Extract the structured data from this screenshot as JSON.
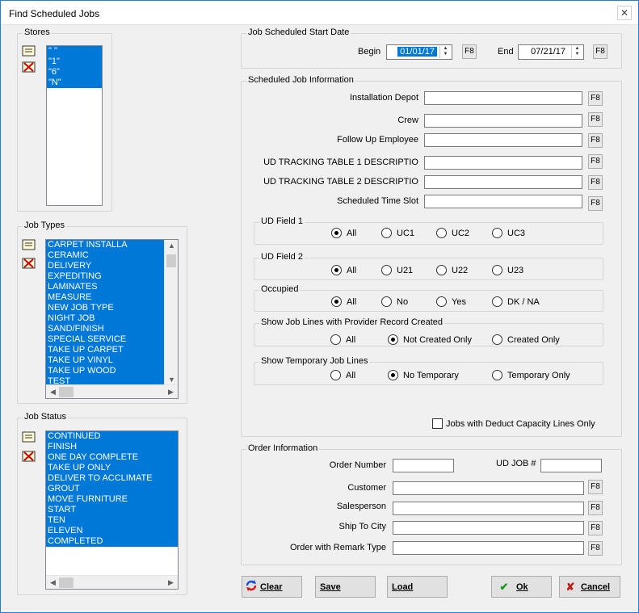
{
  "window": {
    "title": "Find Scheduled Jobs",
    "close_glyph": "✕"
  },
  "stores": {
    "title": "Stores",
    "items": [
      "\" \"",
      "\"1\"",
      "\"6\"",
      "\"N\""
    ]
  },
  "job_types": {
    "title": "Job Types",
    "items": [
      "CARPET INSTALLA",
      "CERAMIC",
      "DELIVERY",
      "EXPEDITING",
      "LAMINATES",
      "MEASURE",
      "NEW JOB TYPE",
      "NIGHT JOB",
      "SAND/FINISH",
      "SPECIAL SERVICE",
      "TAKE UP CARPET",
      "TAKE UP VINYL",
      "TAKE UP WOOD",
      "TEST"
    ]
  },
  "job_status": {
    "title": "Job Status",
    "items": [
      "CONTINUED",
      "FINISH",
      "ONE DAY COMPLETE",
      "TAKE UP ONLY",
      "DELIVER TO ACCLIMATE",
      "GROUT",
      "MOVE FURNITURE",
      "START",
      "TEN",
      "ELEVEN",
      "COMPLETED"
    ]
  },
  "start_date": {
    "title": "Job Scheduled Start Date",
    "begin_label": "Begin",
    "begin_value": "01/01/17",
    "end_label": "End",
    "end_value": "07/21/17",
    "f8": "F8"
  },
  "job_info": {
    "title": "Scheduled Job Information",
    "fields": [
      "Installation Depot",
      "Crew",
      "Follow Up Employee",
      "UD TRACKING TABLE 1 DESCRIPTIO",
      "UD TRACKING TABLE 2 DESCRIPTIO",
      "Scheduled Time Slot"
    ],
    "f8": "F8",
    "ud_field1": {
      "title": "UD Field 1",
      "options": [
        "All",
        "UC1",
        "UC2",
        "UC3"
      ],
      "selected": 0
    },
    "ud_field2": {
      "title": "UD Field 2",
      "options": [
        "All",
        "U21",
        "U22",
        "U23"
      ],
      "selected": 0
    },
    "occupied": {
      "title": "Occupied",
      "options": [
        "All",
        "No",
        "Yes",
        "DK / NA"
      ],
      "selected": 0
    },
    "provider": {
      "title": "Show Job Lines with Provider Record Created",
      "options": [
        "All",
        "Not Created Only",
        "Created Only"
      ],
      "selected": 1
    },
    "temporary": {
      "title": "Show Temporary Job Lines",
      "options": [
        "All",
        "No Temporary",
        "Temporary Only"
      ],
      "selected": 1
    },
    "deduct_label": "Jobs with Deduct Capacity Lines Only"
  },
  "order_info": {
    "title": "Order Information",
    "order_number": "Order Number",
    "ud_job": "UD JOB #",
    "fields": [
      "Customer",
      "Salesperson",
      "Ship To City",
      "Order with Remark Type"
    ],
    "f8": "F8"
  },
  "buttons": {
    "clear": "Clear",
    "save": "Save",
    "load": "Load",
    "ok": "Ok",
    "cancel": "Cancel"
  },
  "colors": {
    "selection": "#0078d7",
    "accent_border": "#1e7fd8"
  }
}
